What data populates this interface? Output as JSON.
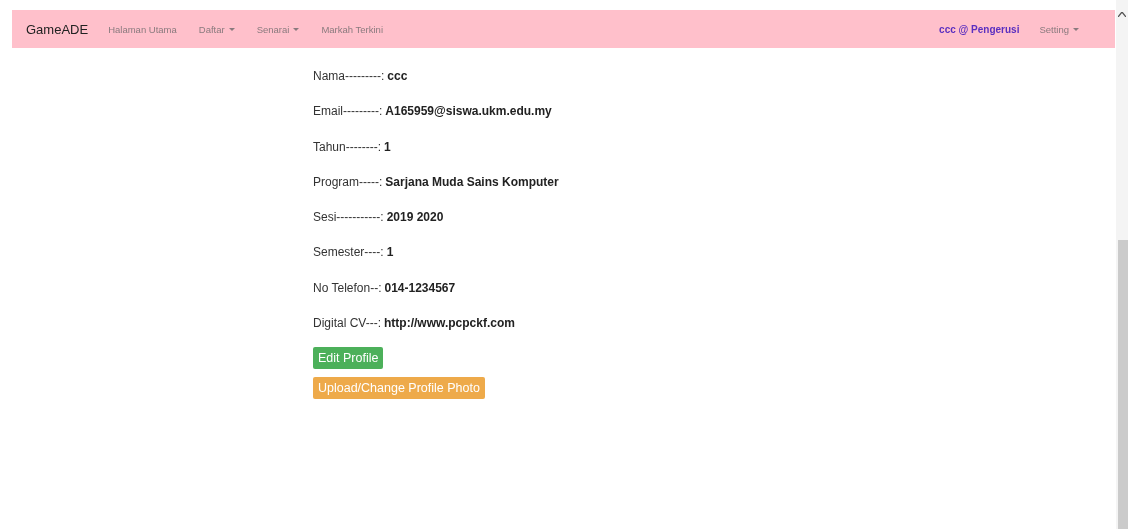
{
  "navbar": {
    "brand": "GameADE",
    "items": [
      {
        "label": "Halaman Utama",
        "dropdown": false
      },
      {
        "label": "Daftar",
        "dropdown": true
      },
      {
        "label": "Senarai",
        "dropdown": true
      },
      {
        "label": "Markah Terkini",
        "dropdown": false
      }
    ],
    "user": "ccc @ Pengerusi",
    "setting": {
      "label": "Setting",
      "dropdown": true
    }
  },
  "profile": [
    {
      "label": "Nama---------:",
      "value": "ccc"
    },
    {
      "label": "Email---------:",
      "value": "A165959@siswa.ukm.edu.my"
    },
    {
      "label": "Tahun--------:",
      "value": "1"
    },
    {
      "label": "Program-----:",
      "value": "Sarjana Muda Sains Komputer"
    },
    {
      "label": "Sesi-----------:",
      "value": "2019 2020"
    },
    {
      "label": "Semester----:",
      "value": "1"
    },
    {
      "label": "No Telefon--:",
      "value": "014-1234567"
    },
    {
      "label": "Digital CV---:",
      "value": "http://www.pcpckf.com"
    }
  ],
  "buttons": [
    {
      "label": "Edit Profile",
      "kind": "success"
    },
    {
      "label": "Upload/Change Profile Photo",
      "kind": "warning"
    }
  ]
}
